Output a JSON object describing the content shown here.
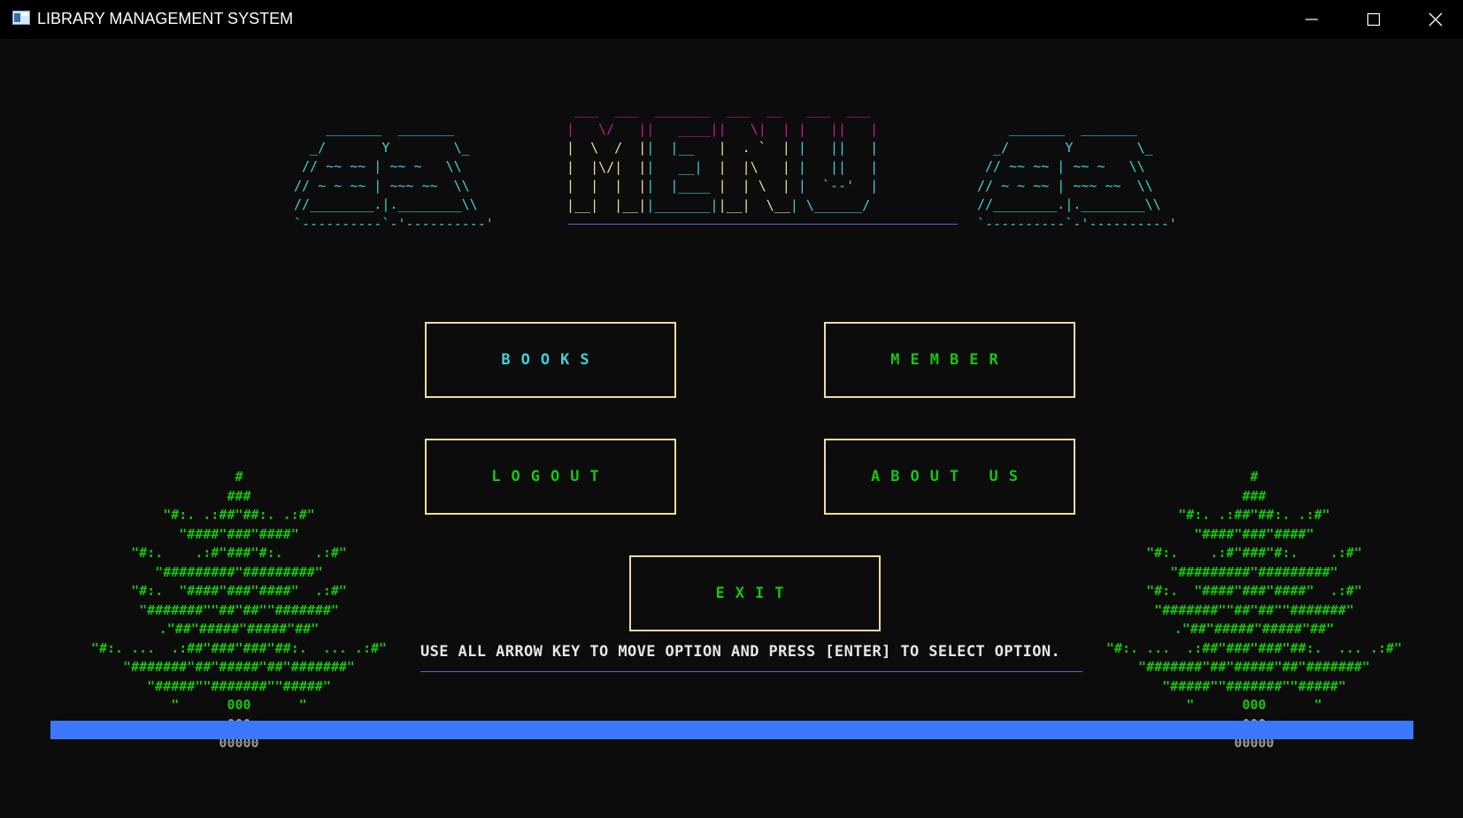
{
  "window": {
    "title": "LIBRARY MANAGEMENT SYSTEM",
    "controls": {
      "minimize": "—",
      "maximize": "☐",
      "close": "✕"
    }
  },
  "header": {
    "menu_art": [
      " ___  ___  _______  ___  __   ___  ___ ",
      "|   \\/   ||   ____||   \\|  | |   ||   |",
      "|  \\  /  ||  |__   |  . `  | |   ||   |",
      "|  |\\/|  ||   __|  |  |\\   | |   ||   |",
      "|  |  |  ||  |____ |  | \\  | |  `--'  |",
      "|__|  |__||_______||__|  \\__| \\______/ "
    ],
    "book_art": [
      "    _______  _______   ",
      "  _/       Y        \\_ ",
      " // ~~ ~~ | ~~ ~   \\\\ ",
      "// ~ ~ ~~ | ~~~ ~~  \\\\",
      "//________.|.________\\\\",
      "`----------`-'----------'"
    ]
  },
  "options": {
    "books": "BOOKS",
    "member": "MEMBER",
    "logout": "LOGOUT",
    "about": "ABOUT US",
    "exit": "EXIT"
  },
  "instruction": "USE ALL ARROW KEY TO MOVE OPTION AND PRESS [ENTER] TO SELECT OPTION.",
  "tree": {
    "foliage": [
      "#",
      "###",
      "\"#:. .:##\"##:. .:#\"",
      "\"####\"###\"####\"",
      "\"#:.    .:#\"###\"#:.    .:#\"",
      "\"#########\"#########\"",
      "\"#:.  \"####\"###\"####\"  .:#\"",
      "\"#######\"\"##\"##\"\"#######\"",
      ".\"##\"#####\"#####\"##\"",
      "\"#:. ...  .:##\"###\"###\"##:.  ... .:#\"",
      "\"#######\"##\"#####\"##\"#######\"",
      "\"#####\"\"#######\"\"#####\""
    ],
    "base_line": "\"      000      \"",
    "trunk_1": "000",
    "trunk_2": "00000"
  },
  "progress": {
    "value": 1.0
  },
  "colors": {
    "accent_cyan": "#3fd1d8",
    "option_border": "#f2dd9c",
    "option_text_books": "#3fd1d8",
    "option_text_green": "#16c60c",
    "progress": "#3b78ff",
    "rule": "#4c66d8",
    "magenta": "#c8189c",
    "yellow": "#f2dd9c"
  }
}
